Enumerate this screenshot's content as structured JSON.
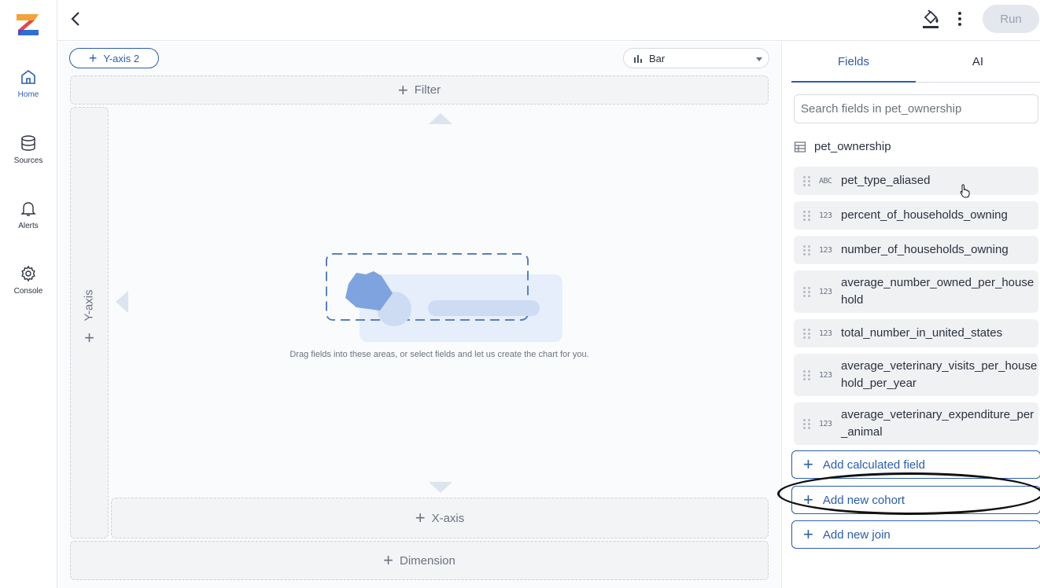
{
  "nav": {
    "items": [
      {
        "label": "Home",
        "icon": "home-icon"
      },
      {
        "label": "Sources",
        "icon": "database-icon"
      },
      {
        "label": "Alerts",
        "icon": "bell-icon"
      },
      {
        "label": "Console",
        "icon": "gear-icon"
      }
    ]
  },
  "topbar": {
    "run_label": "Run"
  },
  "builder": {
    "yaxis2_label": "Y-axis 2",
    "chart_type": "Bar",
    "filter_label": "Filter",
    "yaxis_label": "Y-axis",
    "xaxis_label": "X-axis",
    "dimension_label": "Dimension",
    "hint": "Drag fields into these areas, or select fields and let us create the chart for you."
  },
  "panel": {
    "tabs": [
      {
        "label": "Fields"
      },
      {
        "label": "AI"
      }
    ],
    "search_placeholder": "Search fields in pet_ownership",
    "table_name": "pet_ownership",
    "fields": [
      {
        "type": "ABC",
        "name": "pet_type_aliased"
      },
      {
        "type": "123",
        "name": "percent_of_households_owning"
      },
      {
        "type": "123",
        "name": "number_of_households_owning"
      },
      {
        "type": "123",
        "name": "average_number_owned_per_household"
      },
      {
        "type": "123",
        "name": "total_number_in_united_states"
      },
      {
        "type": "123",
        "name": "average_veterinary_visits_per_household_per_year"
      },
      {
        "type": "123",
        "name": "average_veterinary_expenditure_per_animal"
      }
    ],
    "actions": [
      {
        "label": "Add calculated field"
      },
      {
        "label": "Add new cohort"
      },
      {
        "label": "Add new join"
      }
    ]
  },
  "colors": {
    "accent": "#2b5ea8",
    "dropzone_bg": "#f3f4f6",
    "run_disabled_bg": "#e4e7ee"
  }
}
